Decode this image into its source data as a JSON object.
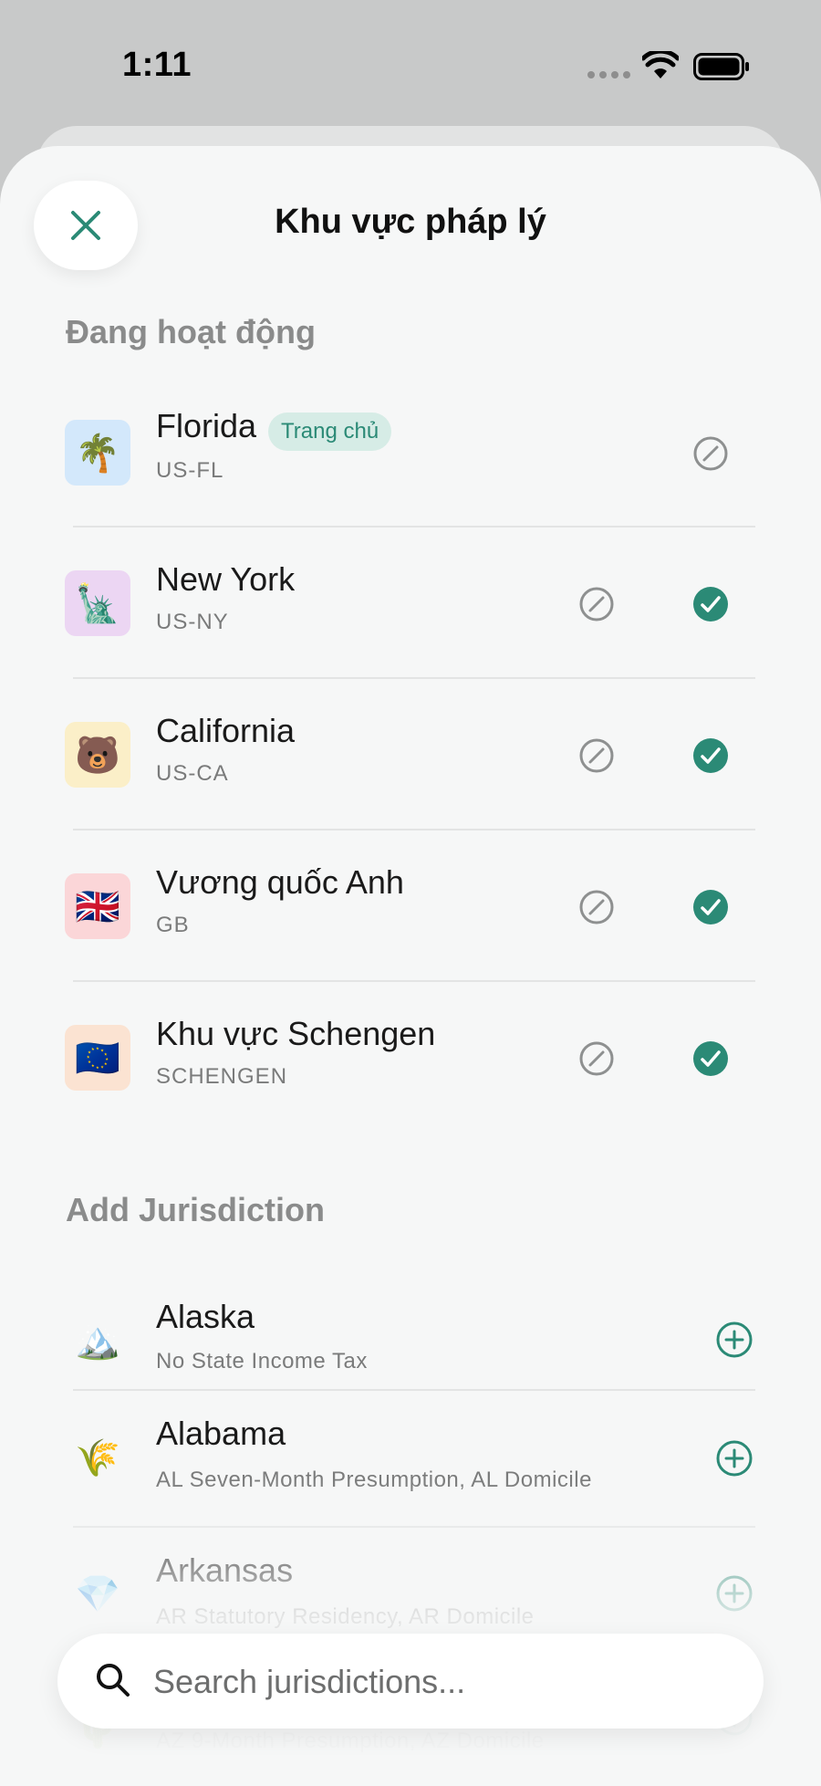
{
  "status_bar": {
    "time": "1:11"
  },
  "header": {
    "title": "Khu vực pháp lý"
  },
  "active_section": {
    "title": "Đang hoạt động",
    "items": [
      {
        "name": "Florida",
        "code": "US-FL",
        "badge": "Trang chủ",
        "icon": "🌴",
        "icon_bg": "#d3e8fb"
      },
      {
        "name": "New York",
        "code": "US-NY",
        "icon": "🗽",
        "icon_bg": "#ecd6f3"
      },
      {
        "name": "California",
        "code": "US-CA",
        "icon": "🐻",
        "icon_bg": "#fbefc8"
      },
      {
        "name": "Vương quốc Anh",
        "code": "GB",
        "icon": "🇬🇧",
        "icon_bg": "#fbd6d8"
      },
      {
        "name": "Khu vực Schengen",
        "code": "SCHENGEN",
        "icon": "🇪🇺",
        "icon_bg": "#fbe3d2"
      }
    ]
  },
  "add_section": {
    "title": "Add Jurisdiction",
    "items": [
      {
        "name": "Alaska",
        "description": "No State Income Tax",
        "icon": "🏔️"
      },
      {
        "name": "Alabama",
        "description": "AL Seven-Month Presumption, AL Domicile",
        "icon": "🌾"
      },
      {
        "name": "Arkansas",
        "description": "AR Statutory Residency, AR Domicile",
        "icon": "💎"
      },
      {
        "name": "",
        "description": "AZ 9-Month Presumption, AZ Domicile",
        "icon": "🌵"
      }
    ]
  },
  "search": {
    "placeholder": "Search jurisdictions..."
  },
  "colors": {
    "accent": "#2b8a76",
    "muted": "#8a8b8b",
    "sheet": "#f6f7f7"
  }
}
